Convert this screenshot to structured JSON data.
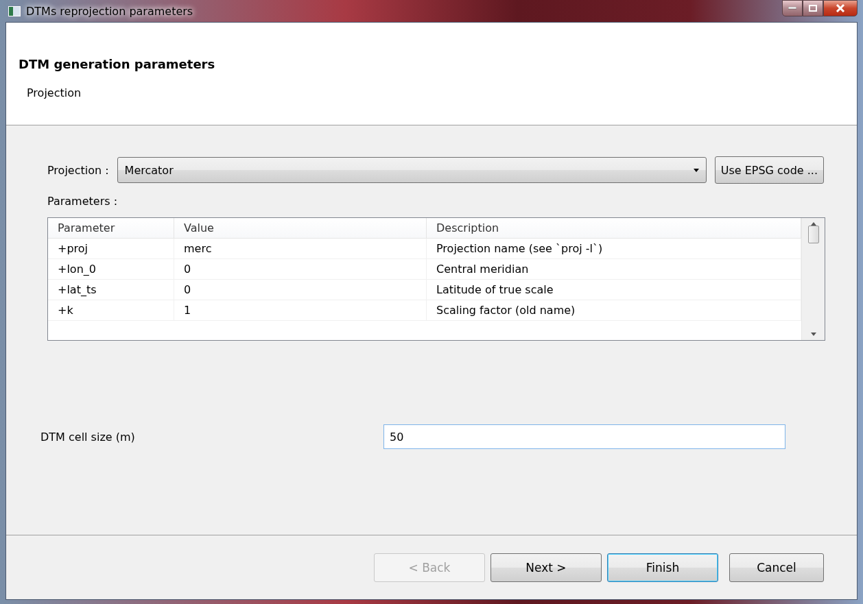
{
  "window": {
    "title": "DTMs reprojection parameters"
  },
  "header": {
    "title": "DTM generation parameters",
    "subtitle": "Projection"
  },
  "projection": {
    "label": "Projection :",
    "value": "Mercator",
    "button": "Use EPSG code ..."
  },
  "parameters": {
    "label": "Parameters :",
    "columns": [
      "Parameter",
      "Value",
      "Description"
    ],
    "rows": [
      {
        "cells": [
          "+proj",
          "merc",
          "Projection name (see `proj -l`)"
        ]
      },
      {
        "cells": [
          "+lon_0",
          "0",
          "Central meridian"
        ]
      },
      {
        "cells": [
          "+lat_ts",
          "0",
          "Latitude of true scale"
        ]
      },
      {
        "cells": [
          "+k",
          "1",
          "Scaling factor (old name)"
        ]
      }
    ]
  },
  "cell_size": {
    "label": "DTM cell size (m)",
    "value": "50"
  },
  "buttons": [
    {
      "label": "< Back",
      "disabled": true,
      "default": false
    },
    {
      "label": "Next >",
      "disabled": false,
      "default": false
    },
    {
      "label": "Finish",
      "disabled": false,
      "default": true
    },
    {
      "label": "Cancel",
      "disabled": false,
      "default": false
    }
  ]
}
